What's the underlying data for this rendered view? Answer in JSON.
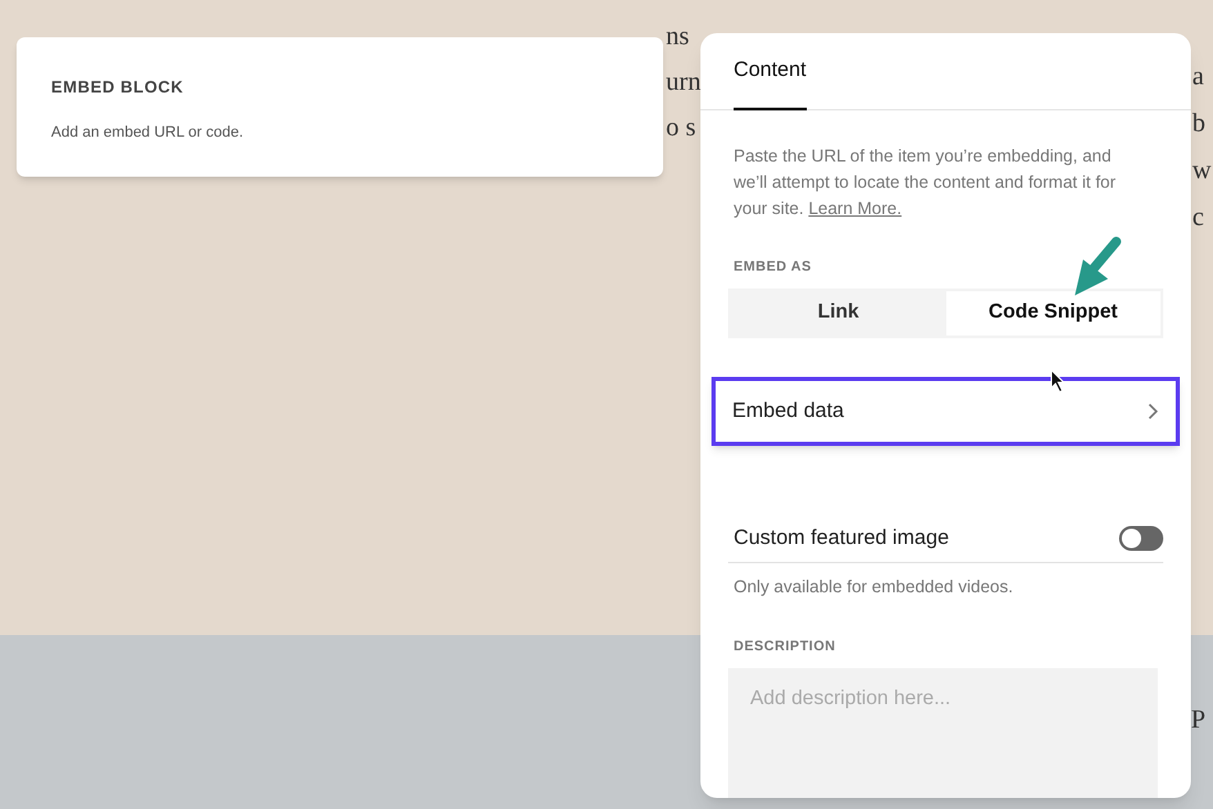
{
  "background_text": {
    "left_fragments": [
      "ns",
      "urn",
      "o s"
    ],
    "right_fragments": [
      "a",
      "b",
      "w",
      "c"
    ],
    "lower_fragment": "P"
  },
  "embed_block": {
    "title": "EMBED BLOCK",
    "subtitle": "Add an embed URL or code."
  },
  "panel": {
    "tabs": [
      {
        "label": "Content",
        "selected": true
      }
    ],
    "intro": "Paste the URL of the item you’re embedding, and we’ll attempt to locate the content and format it for your site.",
    "learn_more": "Learn More.",
    "embed_as": {
      "label": "EMBED AS",
      "options": [
        {
          "label": "Link",
          "selected": false
        },
        {
          "label": "Code Snippet",
          "selected": true
        }
      ]
    },
    "embed_data": {
      "label": "Embed data",
      "highlighted": true
    },
    "custom_featured_image": {
      "label": "Custom featured image",
      "on": false,
      "note": "Only available for embedded videos."
    },
    "description": {
      "label": "DESCRIPTION",
      "placeholder": "Add description here..."
    }
  }
}
